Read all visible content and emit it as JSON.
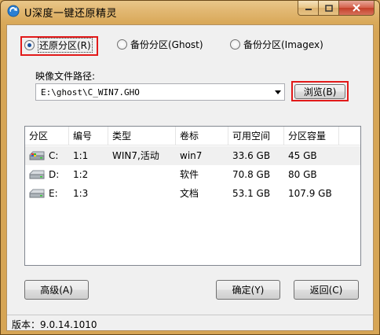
{
  "window": {
    "title": "U深度一键还原精灵"
  },
  "mode_options": [
    {
      "label": "还原分区(R)",
      "checked": true
    },
    {
      "label": "备份分区(Ghost)",
      "checked": false
    },
    {
      "label": "备份分区(Imagex)",
      "checked": false
    }
  ],
  "image_path": {
    "label": "映像文件路径:",
    "value": "E:\\ghost\\C_WIN7.GHO",
    "browse_label": "浏览(B)"
  },
  "table": {
    "columns": [
      "分区",
      "编号",
      "类型",
      "卷标",
      "可用空间",
      "分区容量"
    ],
    "rows": [
      {
        "drive": "C:",
        "number": "1:1",
        "type": "WIN7,活动",
        "label": "win7",
        "free": "33.6 GB",
        "capacity": "45 GB",
        "icon": "system-disk-icon",
        "selected": true
      },
      {
        "drive": "D:",
        "number": "1:2",
        "type": "",
        "label": "软件",
        "free": "70.8 GB",
        "capacity": "80 GB",
        "icon": "disk-icon",
        "selected": false
      },
      {
        "drive": "E:",
        "number": "1:3",
        "type": "",
        "label": "文档",
        "free": "53.1 GB",
        "capacity": "107.9 GB",
        "icon": "disk-icon",
        "selected": false
      }
    ]
  },
  "buttons": {
    "advanced": "高级(A)",
    "ok": "确定(Y)",
    "back": "返回(C)"
  },
  "status": {
    "version": "版本：9.0.14.1010"
  },
  "colors": {
    "frame": "#d9a95a",
    "highlight_box": "#e21a1a"
  }
}
